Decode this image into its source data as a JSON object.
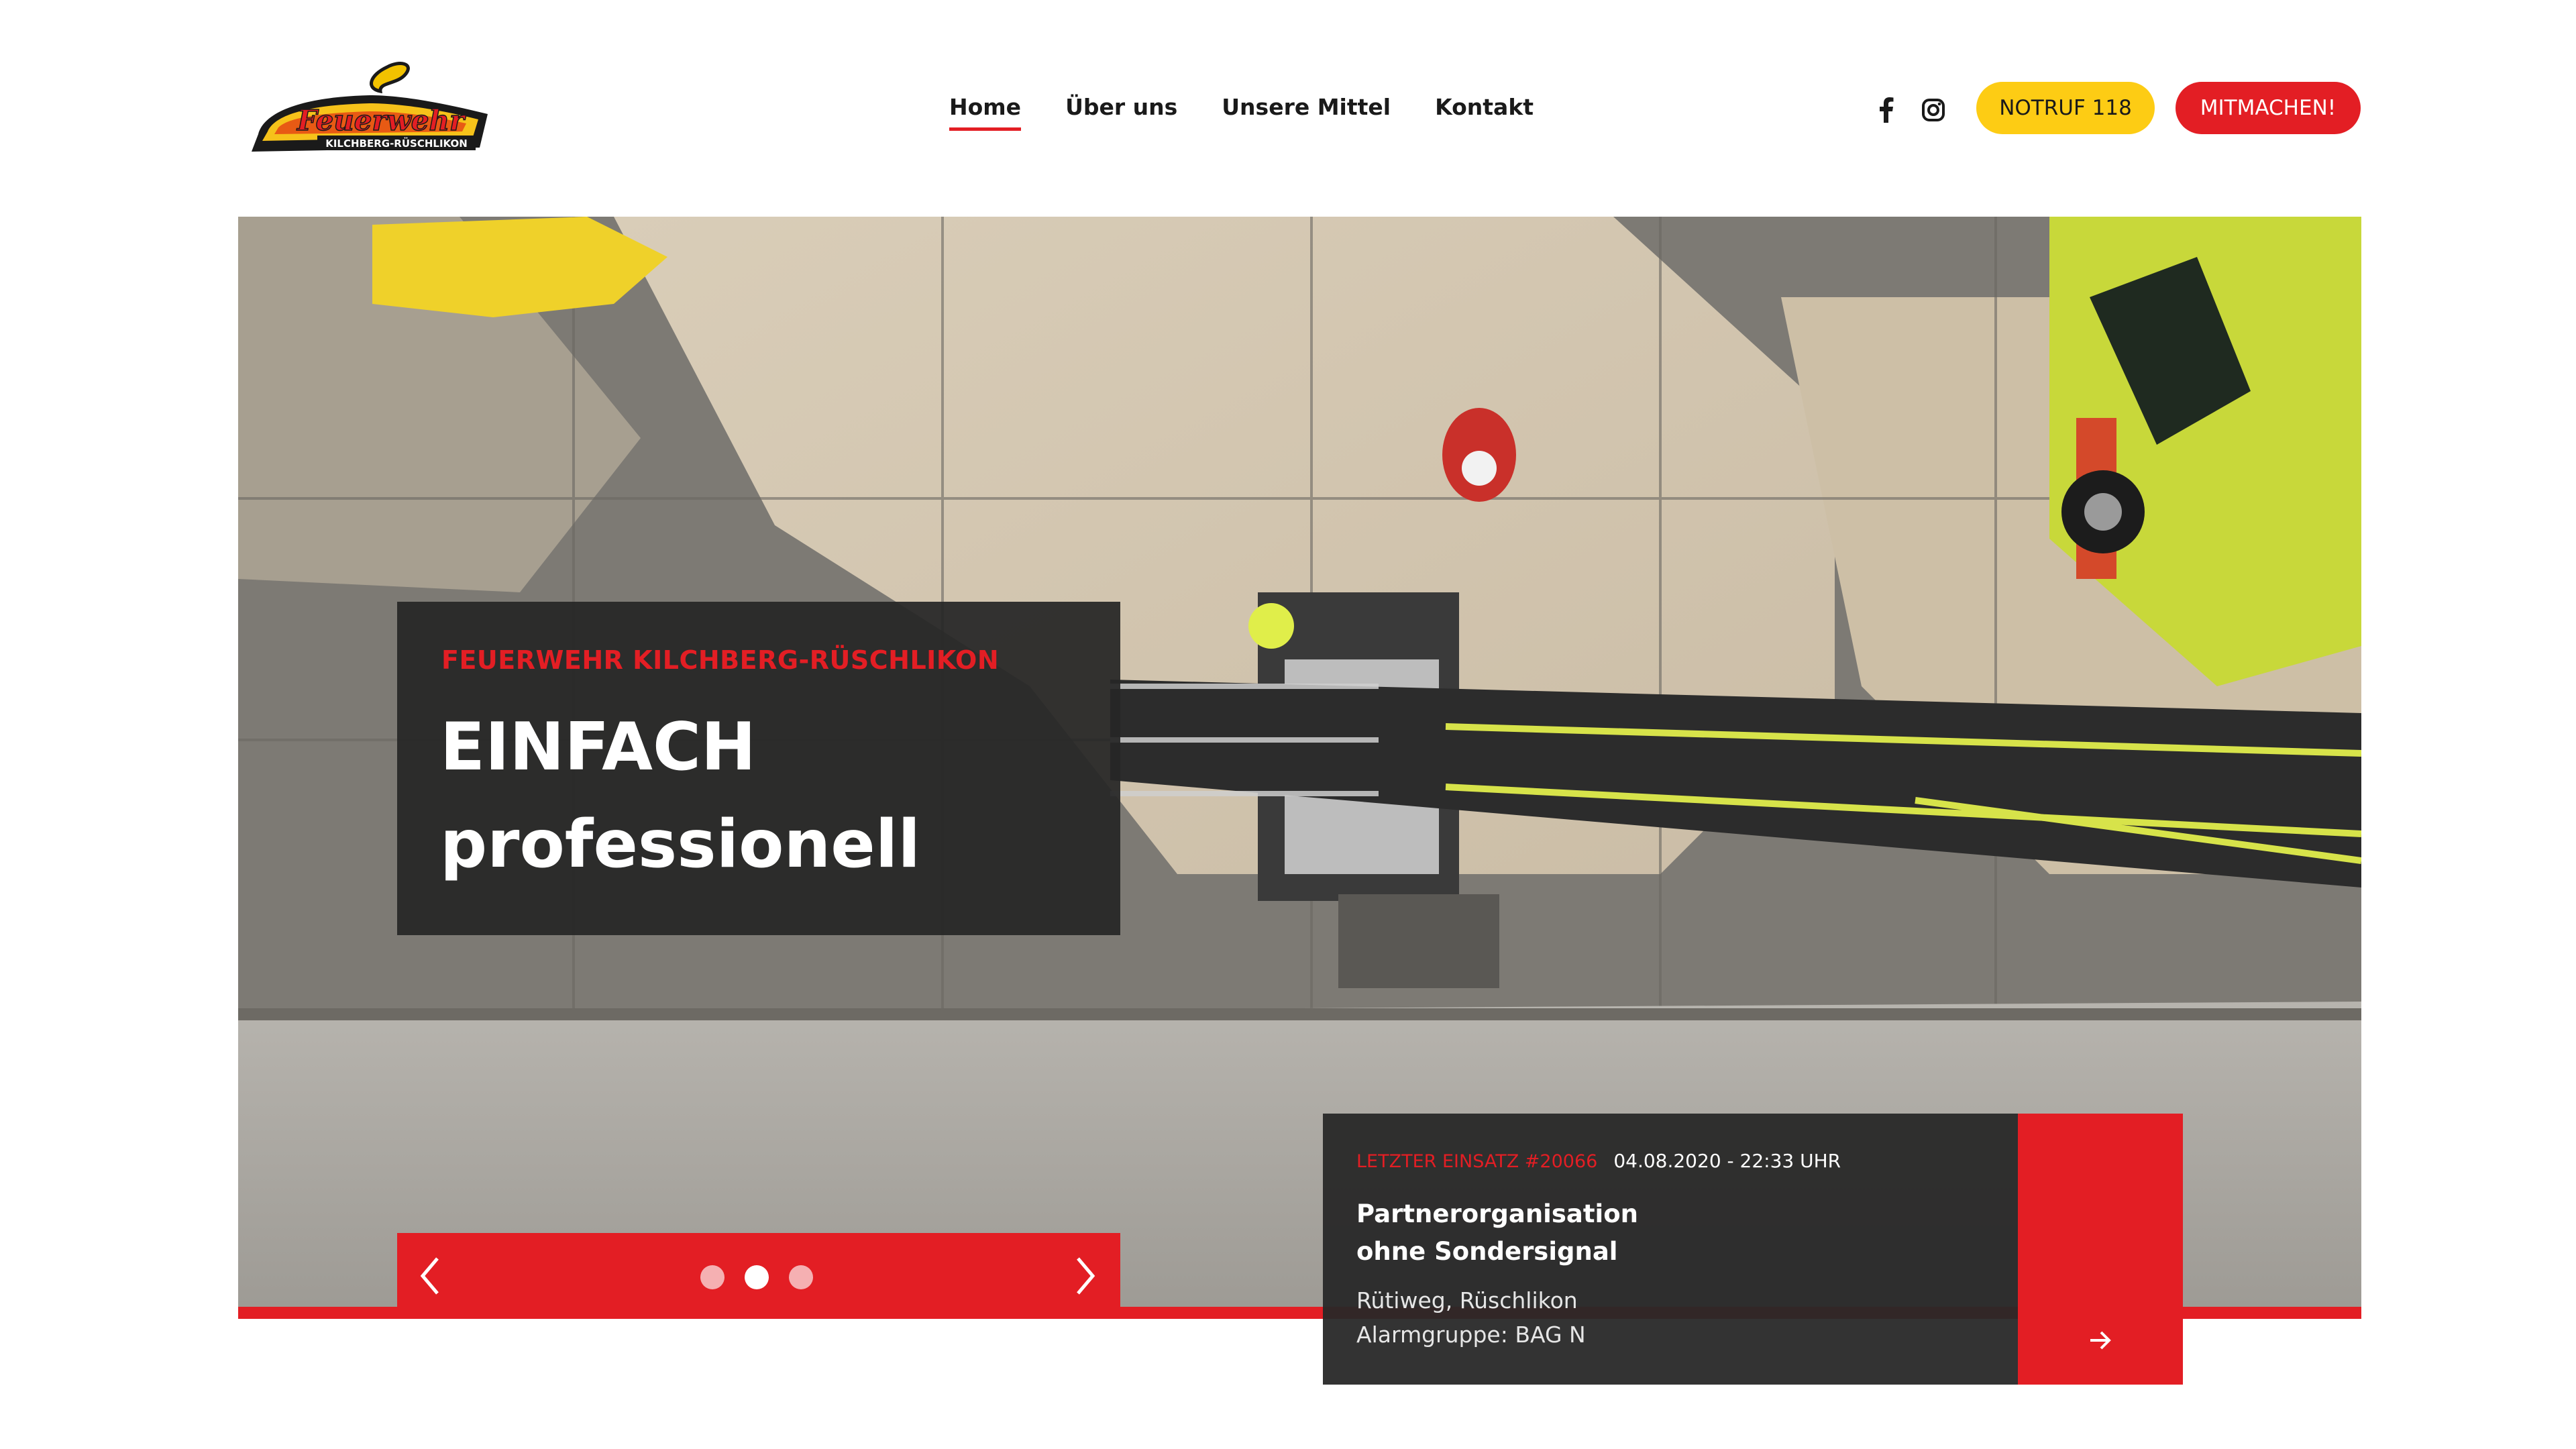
{
  "header": {
    "logo": {
      "name": "feuerwehr-logo",
      "wordmark": "Feuerwehr",
      "subline": "KILCHBERG-RÜSCHLIKON"
    },
    "nav": [
      {
        "label": "Home",
        "active": true
      },
      {
        "label": "Über uns",
        "active": false
      },
      {
        "label": "Unsere Mittel",
        "active": false
      },
      {
        "label": "Kontakt",
        "active": false
      }
    ],
    "social": [
      {
        "icon": "facebook-icon"
      },
      {
        "icon": "instagram-icon"
      }
    ],
    "buttons": {
      "notruf": "NOTRUF 118",
      "mitmachen": "MITMACHEN!"
    }
  },
  "hero": {
    "eyebrow": "FEUERWEHR KILCHBERG-RÜSCHLIKON",
    "title_line1": "EINFACH",
    "title_line2": "professionell",
    "slider": {
      "slides": 3,
      "active_slide": 2,
      "prev_icon": "chevron-left-icon",
      "next_icon": "chevron-right-icon"
    }
  },
  "latest_incident": {
    "label": "LETZTER EINSATZ #20066",
    "datetime": "04.08.2020 - 22:33 UHR",
    "title_line1": "Partnerorganisation",
    "title_line2": "ohne Sondersignal",
    "location": "Rütiweg, Rüschlikon",
    "alarm_group": "Alarmgruppe: BAG N",
    "button_icon": "arrow-right-icon"
  },
  "colors": {
    "brand_red": "#e31e24",
    "notruf_yellow": "#fdcc14",
    "dark_overlay": "#262626"
  }
}
